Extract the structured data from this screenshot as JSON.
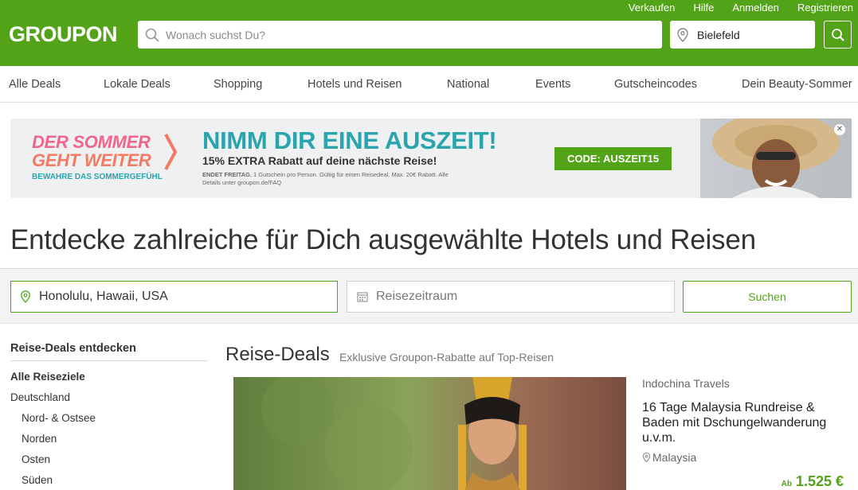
{
  "header": {
    "logo": "GROUPON",
    "top_links": [
      "Verkaufen",
      "Hilfe",
      "Anmelden",
      "Registrieren"
    ],
    "search_placeholder": "Wonach suchst Du?",
    "location": "Bielefeld"
  },
  "nav": {
    "items": [
      "Alle Deals",
      "Lokale Deals",
      "Shopping",
      "Hotels und Reisen",
      "National",
      "Events",
      "Gutscheincodes",
      "Dein Beauty-Sommer"
    ]
  },
  "banner": {
    "line1": "DER SOMMER",
    "line2": "GEHT WEITER",
    "sub": "BEWAHRE DAS SOMMERGEFÜHL",
    "headline": "NIMM DIR EINE AUSZEIT!",
    "offer": "15% EXTRA Rabatt auf deine nächste Reise!",
    "fine_bold": "ENDET FREITAG.",
    "fine": "1 Gutschein pro Person. Gültig für einen Reisedeal. Max. 20€ Rabatt. Alle Details unter groupon.de/FAQ",
    "code": "CODE: AUSZEIT15"
  },
  "page": {
    "headline": "Entdecke zahlreiche für Dich ausgewählte Hotels und Reisen"
  },
  "search_band": {
    "destination": "Honolulu, Hawaii, USA",
    "dates": "Reisezeitraum",
    "button": "Suchen"
  },
  "sidebar": {
    "title": "Reise-Deals entdecken",
    "items": [
      "Alle Reiseziele",
      "Deutschland",
      "Nord- & Ostsee",
      "Norden",
      "Osten",
      "Süden"
    ]
  },
  "deals": {
    "title": "Reise-Deals",
    "subtitle": "Exklusive Groupon-Rabatte auf Top-Reisen",
    "card": {
      "provider": "Indochina Travels",
      "title": "16 Tage Malaysia Rundreise & Baden mit Dschungelwanderung u.v.m.",
      "location": "Malaysia",
      "price_prefix": "Ab",
      "price": "1.525 €"
    }
  },
  "colors": {
    "brand_green": "#53a318",
    "banner_teal": "#2aa4ad",
    "banner_pink": "#f0658a"
  }
}
